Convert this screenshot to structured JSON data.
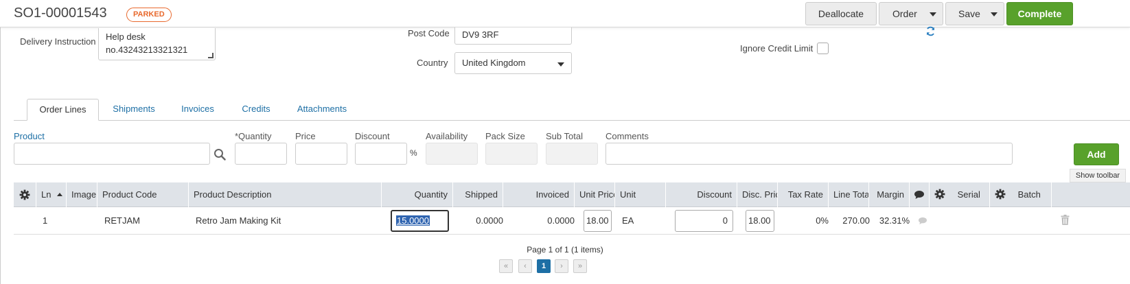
{
  "header": {
    "order_number": "SO1-00001543",
    "status": "PARKED",
    "buttons": {
      "deallocate": "Deallocate",
      "order": "Order",
      "save": "Save",
      "complete": "Complete"
    }
  },
  "form": {
    "delivery_instruction": {
      "label": "Delivery Instruction",
      "value_line1": "Help desk",
      "value_line2": "no.43243213321321"
    },
    "post_code": {
      "label": "Post Code",
      "value": "DV9 3RF"
    },
    "country": {
      "label": "Country",
      "value": "United Kingdom"
    },
    "ignore_credit_limit": {
      "label": "Ignore Credit Limit",
      "checked": false
    }
  },
  "tabs": [
    {
      "label": "Order Lines",
      "active": true
    },
    {
      "label": "Shipments",
      "active": false
    },
    {
      "label": "Invoices",
      "active": false
    },
    {
      "label": "Credits",
      "active": false
    },
    {
      "label": "Attachments",
      "active": false
    }
  ],
  "entry": {
    "product_label": "Product",
    "quantity_label": "*Quantity",
    "price_label": "Price",
    "discount_label": "Discount",
    "percent_sign": "%",
    "availability_label": "Availability",
    "pack_size_label": "Pack Size",
    "sub_total_label": "Sub Total",
    "comments_label": "Comments",
    "add_button": "Add",
    "show_toolbar": "Show toolbar"
  },
  "grid": {
    "columns": {
      "ln": "Ln",
      "image": "Image",
      "product_code": "Product Code",
      "product_description": "Product Description",
      "quantity": "Quantity",
      "shipped": "Shipped",
      "invoiced": "Invoiced",
      "unit_price": "Unit Price",
      "unit": "Unit",
      "discount": "Discount",
      "disc_price": "Disc. Price",
      "tax_rate": "Tax Rate",
      "line_total": "Line Total",
      "margin": "Margin",
      "serial": "Serial",
      "batch": "Batch"
    },
    "rows": [
      {
        "ln": "1",
        "product_code": "RETJAM",
        "product_description": "Retro Jam Making Kit",
        "quantity": "15.0000",
        "shipped": "0.0000",
        "invoiced": "0.0000",
        "unit_price": "18.00",
        "unit": "EA",
        "discount": "0",
        "disc_price": "18.00",
        "tax_rate": "0%",
        "line_total": "270.00",
        "margin": "32.31%"
      }
    ]
  },
  "pager": {
    "info": "Page 1 of 1 (1 items)",
    "first": "«",
    "prev": "‹",
    "current": "1",
    "next": "›",
    "last": "»"
  },
  "colors": {
    "accent_green": "#58a12b",
    "link_blue": "#1d6fa5",
    "parked_orange": "#e8692d"
  }
}
